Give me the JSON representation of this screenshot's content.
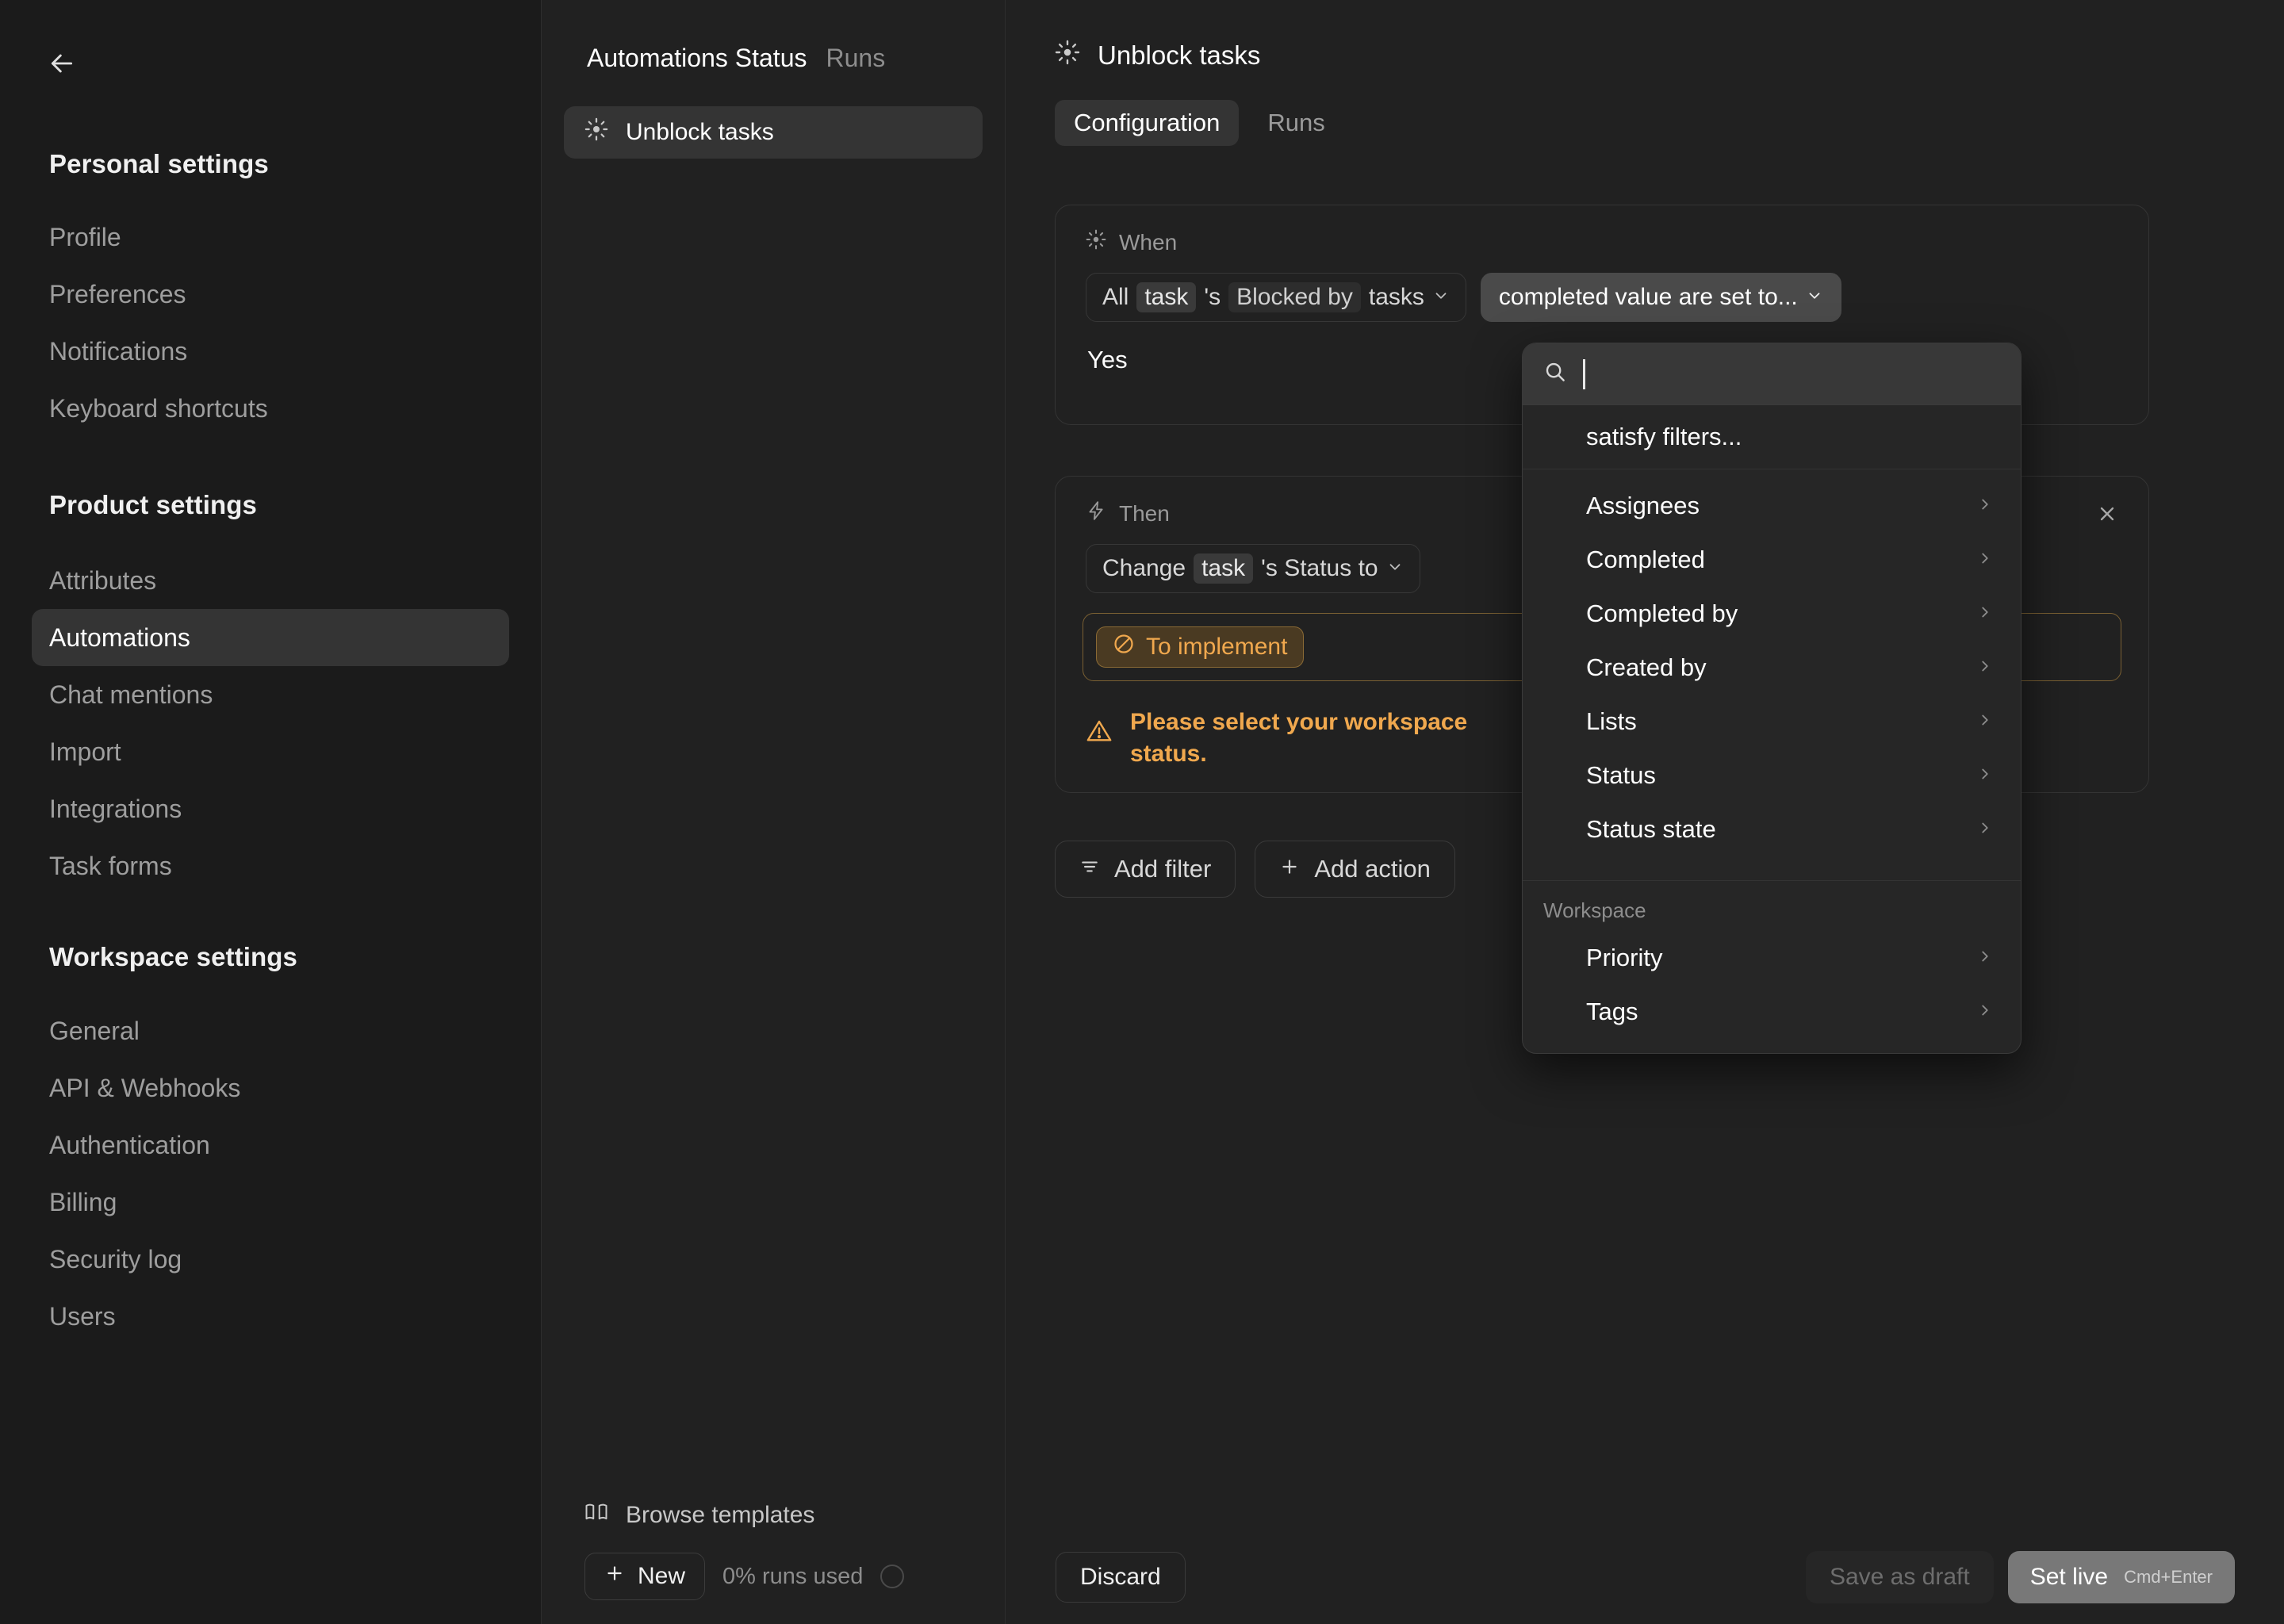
{
  "sidebar": {
    "back_icon": "arrow-left-icon",
    "groups": [
      {
        "title": "Personal settings",
        "items": [
          {
            "label": "Profile"
          },
          {
            "label": "Preferences"
          },
          {
            "label": "Notifications"
          },
          {
            "label": "Keyboard shortcuts"
          }
        ]
      },
      {
        "title": "Product settings",
        "items": [
          {
            "label": "Attributes"
          },
          {
            "label": "Automations"
          },
          {
            "label": "Chat mentions"
          },
          {
            "label": "Import"
          },
          {
            "label": "Integrations"
          },
          {
            "label": "Task forms"
          }
        ]
      },
      {
        "title": "Workspace settings",
        "items": [
          {
            "label": "General"
          },
          {
            "label": "API & Webhooks"
          },
          {
            "label": "Authentication"
          },
          {
            "label": "Billing"
          },
          {
            "label": "Security log"
          },
          {
            "label": "Users"
          }
        ]
      }
    ],
    "active_item": "Automations"
  },
  "middle": {
    "tab_automations_status": "Automations Status",
    "tab_runs": "Runs",
    "list_item": {
      "label": "Unblock tasks",
      "icon": "automation-sun-icon"
    },
    "browse_templates": {
      "label": "Browse templates",
      "icon": "book-icon"
    },
    "new_button": {
      "label": "New",
      "icon": "plus-icon"
    },
    "runs_used": "0% runs used"
  },
  "detail": {
    "title": "Unblock tasks",
    "title_icon": "automation-sun-icon",
    "tabs": [
      {
        "label": "Configuration",
        "active": true
      },
      {
        "label": "Runs",
        "active": false
      }
    ],
    "when_card": {
      "label": "When",
      "icon": "automation-sun-icon",
      "trigger": {
        "prefix": "All",
        "chip1": "task",
        "possessive": "'s",
        "relation": "Blocked by",
        "chip2": "tasks",
        "chevron": "chevron-down-icon"
      },
      "condition": {
        "label": "completed value are set to...",
        "chevron": "chevron-down-icon"
      },
      "value_text": "Yes"
    },
    "then_card": {
      "label": "Then",
      "icon": "lightning-bolt-icon",
      "close_icon": "close-icon",
      "action": {
        "prefix": "Change",
        "chip": "task",
        "suffix": "'s Status to",
        "chevron": "chevron-down-icon"
      },
      "status_chip": {
        "label": "To implement",
        "icon": "blocked-circle-icon"
      },
      "warning": {
        "icon": "warning-triangle-icon",
        "text": "Please select your workspace status."
      }
    },
    "add_filter": {
      "label": "Add filter",
      "icon": "filter-icon"
    },
    "add_action": {
      "label": "Add action",
      "icon": "plus-icon"
    }
  },
  "dropdown": {
    "search_icon": "search-icon",
    "search_value": "",
    "search_placeholder": "",
    "first_row": "satisfy filters...",
    "items": [
      {
        "label": "Assignees",
        "chevron": "chevron-right-icon"
      },
      {
        "label": "Completed",
        "chevron": "chevron-right-icon"
      },
      {
        "label": "Completed by",
        "chevron": "chevron-right-icon"
      },
      {
        "label": "Created by",
        "chevron": "chevron-right-icon"
      },
      {
        "label": "Lists",
        "chevron": "chevron-right-icon"
      },
      {
        "label": "Status",
        "chevron": "chevron-right-icon"
      },
      {
        "label": "Status state",
        "chevron": "chevron-right-icon"
      }
    ],
    "section_label": "Workspace",
    "workspace_items": [
      {
        "label": "Priority",
        "chevron": "chevron-right-icon"
      },
      {
        "label": "Tags",
        "chevron": "chevron-right-icon"
      }
    ]
  },
  "footer": {
    "discard": "Discard",
    "save_draft": "Save as draft",
    "set_live": "Set live",
    "set_live_shortcut": "Cmd+Enter"
  },
  "colors": {
    "accent_orange": "#f0a84e",
    "panel_bg": "#212121",
    "sidebar_bg": "#1b1b1b",
    "active_bg": "#343434"
  }
}
